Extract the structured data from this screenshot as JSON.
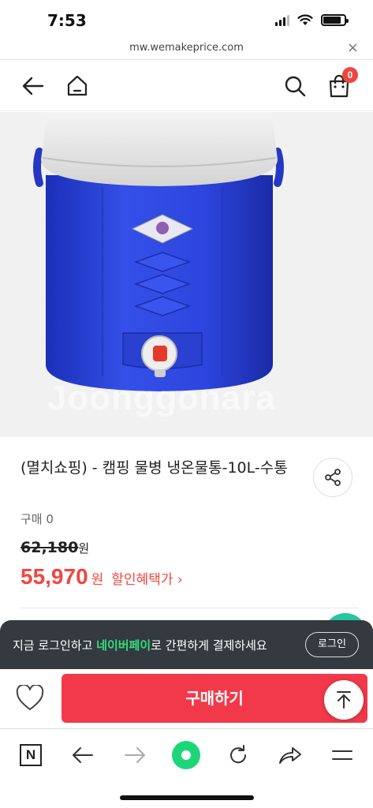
{
  "status_bar": {
    "time": "7:53"
  },
  "browser_url": {
    "url": "mw.wemakeprice.com",
    "close_label": "×"
  },
  "header": {
    "cart_badge": "0"
  },
  "product": {
    "image_watermark": "Joonggonara",
    "title": "(멸치쇼핑) - 캠핑 물병 냉온물통-10L-수통",
    "purchase_count": "구매 0",
    "original_price": "62,180",
    "original_unit": "원",
    "sale_price": "55,970",
    "sale_unit": "원",
    "benefit_label": "할인혜택가 ›"
  },
  "login_banner": {
    "text_before": "지금 로그인하고 ",
    "highlight": "네이버페이",
    "text_after": "로 간편하게 결제하세요",
    "login_button": "로그인"
  },
  "buy_bar": {
    "buy_button": "구매하기"
  },
  "browser_nav": {
    "n_label": "N"
  },
  "colors": {
    "accent": "#f2453f",
    "buy": "#f2394a",
    "naverpay": "#2ee07a",
    "banner_bg": "#343a40"
  }
}
